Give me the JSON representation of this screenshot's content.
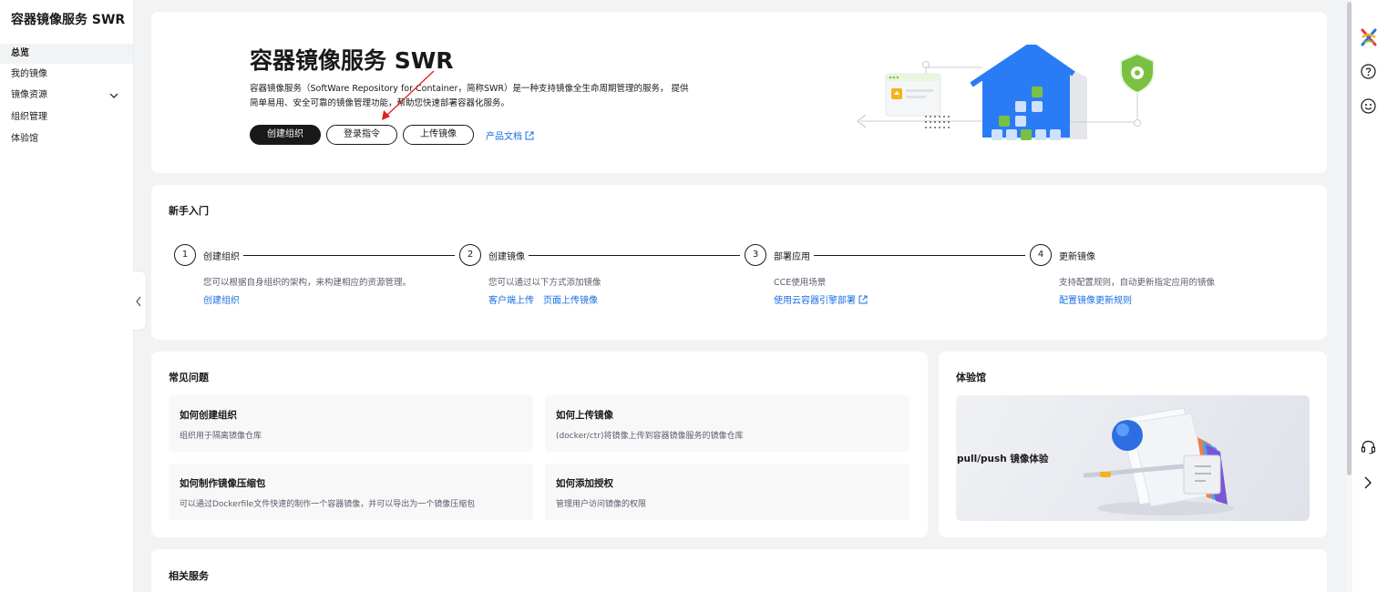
{
  "sidebar": {
    "title": "容器镜像服务 SWR",
    "items": [
      {
        "label": "总览",
        "active": true
      },
      {
        "label": "我的镜像",
        "active": false
      },
      {
        "label": "镜像资源",
        "active": false,
        "expandable": true
      },
      {
        "label": "组织管理",
        "active": false
      },
      {
        "label": "体验馆",
        "active": false
      }
    ]
  },
  "hero": {
    "title": "容器镜像服务 SWR",
    "description": "容器镜像服务（SoftWare Repository for Container，简称SWR）是一种支持镜像全生命周期管理的服务， 提供简单易用、安全可靠的镜像管理功能，帮助您快速部署容器化服务。",
    "buttons": {
      "create_org": "创建组织",
      "login_cmd": "登录指令",
      "upload_image": "上传镜像"
    },
    "doc_link": "产品文档"
  },
  "getting_started": {
    "title": "新手入门",
    "steps": [
      {
        "num": "1",
        "label": "创建组织",
        "desc": "您可以根据自身组织的架构，来构建相应的资源管理。",
        "links": [
          "创建组织"
        ]
      },
      {
        "num": "2",
        "label": "创建镜像",
        "desc": "您可以通过以下方式添加镜像",
        "links": [
          "客户端上传",
          "页面上传镜像"
        ]
      },
      {
        "num": "3",
        "label": "部署应用",
        "desc": "CCE使用场景",
        "links": [
          "使用云容器引擎部署"
        ]
      },
      {
        "num": "4",
        "label": "更新镜像",
        "desc": "支持配置规则，自动更新指定应用的镜像",
        "links": [
          "配置镜像更新规则"
        ]
      }
    ]
  },
  "faq": {
    "title": "常见问题",
    "items": [
      {
        "title": "如何创建组织",
        "desc": "组织用于隔离镜像仓库"
      },
      {
        "title": "如何上传镜像",
        "desc": "(docker/ctr)将镜像上传到容器镜像服务的镜像仓库"
      },
      {
        "title": "如何制作镜像压缩包",
        "desc": "可以通过Dockerfile文件快速的制作一个容器镜像，并可以导出为一个镜像压缩包"
      },
      {
        "title": "如何添加授权",
        "desc": "管理用户访问镜像的权限"
      }
    ]
  },
  "experience": {
    "title": "体验馆",
    "banner_label": "pull/push 镜像体验"
  },
  "related": {
    "title": "相关服务"
  },
  "colors": {
    "accent": "#1a6fe0",
    "primary_button": "#191919",
    "house_blue": "#2a7cf6",
    "green": "#7ac143"
  },
  "rail_icons": [
    "multicolor-logo-icon",
    "help-icon",
    "smiley-icon",
    "headset-icon",
    "chevron-right-icon"
  ]
}
